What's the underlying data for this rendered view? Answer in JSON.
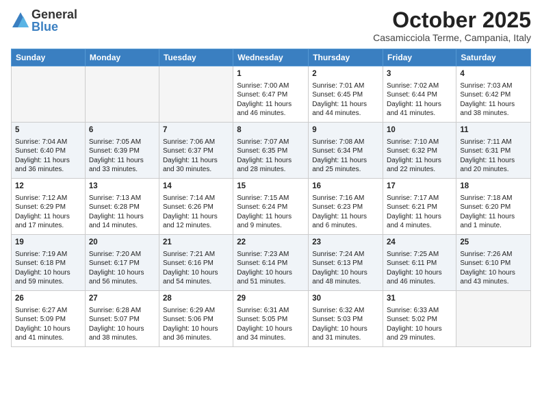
{
  "logo": {
    "general": "General",
    "blue": "Blue"
  },
  "title": "October 2025",
  "location": "Casamicciola Terme, Campania, Italy",
  "headers": [
    "Sunday",
    "Monday",
    "Tuesday",
    "Wednesday",
    "Thursday",
    "Friday",
    "Saturday"
  ],
  "weeks": [
    [
      {
        "day": "",
        "content": ""
      },
      {
        "day": "",
        "content": ""
      },
      {
        "day": "",
        "content": ""
      },
      {
        "day": "1",
        "content": "Sunrise: 7:00 AM\nSunset: 6:47 PM\nDaylight: 11 hours and 46 minutes."
      },
      {
        "day": "2",
        "content": "Sunrise: 7:01 AM\nSunset: 6:45 PM\nDaylight: 11 hours and 44 minutes."
      },
      {
        "day": "3",
        "content": "Sunrise: 7:02 AM\nSunset: 6:44 PM\nDaylight: 11 hours and 41 minutes."
      },
      {
        "day": "4",
        "content": "Sunrise: 7:03 AM\nSunset: 6:42 PM\nDaylight: 11 hours and 38 minutes."
      }
    ],
    [
      {
        "day": "5",
        "content": "Sunrise: 7:04 AM\nSunset: 6:40 PM\nDaylight: 11 hours and 36 minutes."
      },
      {
        "day": "6",
        "content": "Sunrise: 7:05 AM\nSunset: 6:39 PM\nDaylight: 11 hours and 33 minutes."
      },
      {
        "day": "7",
        "content": "Sunrise: 7:06 AM\nSunset: 6:37 PM\nDaylight: 11 hours and 30 minutes."
      },
      {
        "day": "8",
        "content": "Sunrise: 7:07 AM\nSunset: 6:35 PM\nDaylight: 11 hours and 28 minutes."
      },
      {
        "day": "9",
        "content": "Sunrise: 7:08 AM\nSunset: 6:34 PM\nDaylight: 11 hours and 25 minutes."
      },
      {
        "day": "10",
        "content": "Sunrise: 7:10 AM\nSunset: 6:32 PM\nDaylight: 11 hours and 22 minutes."
      },
      {
        "day": "11",
        "content": "Sunrise: 7:11 AM\nSunset: 6:31 PM\nDaylight: 11 hours and 20 minutes."
      }
    ],
    [
      {
        "day": "12",
        "content": "Sunrise: 7:12 AM\nSunset: 6:29 PM\nDaylight: 11 hours and 17 minutes."
      },
      {
        "day": "13",
        "content": "Sunrise: 7:13 AM\nSunset: 6:28 PM\nDaylight: 11 hours and 14 minutes."
      },
      {
        "day": "14",
        "content": "Sunrise: 7:14 AM\nSunset: 6:26 PM\nDaylight: 11 hours and 12 minutes."
      },
      {
        "day": "15",
        "content": "Sunrise: 7:15 AM\nSunset: 6:24 PM\nDaylight: 11 hours and 9 minutes."
      },
      {
        "day": "16",
        "content": "Sunrise: 7:16 AM\nSunset: 6:23 PM\nDaylight: 11 hours and 6 minutes."
      },
      {
        "day": "17",
        "content": "Sunrise: 7:17 AM\nSunset: 6:21 PM\nDaylight: 11 hours and 4 minutes."
      },
      {
        "day": "18",
        "content": "Sunrise: 7:18 AM\nSunset: 6:20 PM\nDaylight: 11 hours and 1 minute."
      }
    ],
    [
      {
        "day": "19",
        "content": "Sunrise: 7:19 AM\nSunset: 6:18 PM\nDaylight: 10 hours and 59 minutes."
      },
      {
        "day": "20",
        "content": "Sunrise: 7:20 AM\nSunset: 6:17 PM\nDaylight: 10 hours and 56 minutes."
      },
      {
        "day": "21",
        "content": "Sunrise: 7:21 AM\nSunset: 6:16 PM\nDaylight: 10 hours and 54 minutes."
      },
      {
        "day": "22",
        "content": "Sunrise: 7:23 AM\nSunset: 6:14 PM\nDaylight: 10 hours and 51 minutes."
      },
      {
        "day": "23",
        "content": "Sunrise: 7:24 AM\nSunset: 6:13 PM\nDaylight: 10 hours and 48 minutes."
      },
      {
        "day": "24",
        "content": "Sunrise: 7:25 AM\nSunset: 6:11 PM\nDaylight: 10 hours and 46 minutes."
      },
      {
        "day": "25",
        "content": "Sunrise: 7:26 AM\nSunset: 6:10 PM\nDaylight: 10 hours and 43 minutes."
      }
    ],
    [
      {
        "day": "26",
        "content": "Sunrise: 6:27 AM\nSunset: 5:09 PM\nDaylight: 10 hours and 41 minutes."
      },
      {
        "day": "27",
        "content": "Sunrise: 6:28 AM\nSunset: 5:07 PM\nDaylight: 10 hours and 38 minutes."
      },
      {
        "day": "28",
        "content": "Sunrise: 6:29 AM\nSunset: 5:06 PM\nDaylight: 10 hours and 36 minutes."
      },
      {
        "day": "29",
        "content": "Sunrise: 6:31 AM\nSunset: 5:05 PM\nDaylight: 10 hours and 34 minutes."
      },
      {
        "day": "30",
        "content": "Sunrise: 6:32 AM\nSunset: 5:03 PM\nDaylight: 10 hours and 31 minutes."
      },
      {
        "day": "31",
        "content": "Sunrise: 6:33 AM\nSunset: 5:02 PM\nDaylight: 10 hours and 29 minutes."
      },
      {
        "day": "",
        "content": ""
      }
    ]
  ]
}
